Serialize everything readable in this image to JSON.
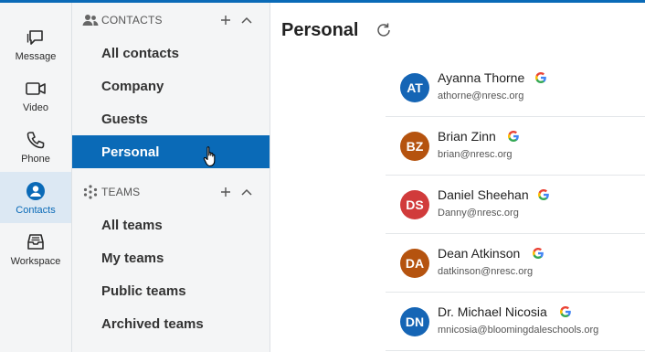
{
  "rail": {
    "items": [
      {
        "label": "Message",
        "icon": "message-icon"
      },
      {
        "label": "Video",
        "icon": "video-icon"
      },
      {
        "label": "Phone",
        "icon": "phone-icon"
      },
      {
        "label": "Contacts",
        "icon": "contacts-icon",
        "active": true
      },
      {
        "label": "Workspace",
        "icon": "workspace-icon"
      }
    ]
  },
  "contacts_section": {
    "title": "CONTACTS",
    "items": [
      {
        "label": "All contacts"
      },
      {
        "label": "Company"
      },
      {
        "label": "Guests"
      },
      {
        "label": "Personal",
        "selected": true
      }
    ]
  },
  "teams_section": {
    "title": "TEAMS",
    "items": [
      {
        "label": "All teams"
      },
      {
        "label": "My teams"
      },
      {
        "label": "Public teams"
      },
      {
        "label": "Archived teams"
      }
    ]
  },
  "main": {
    "title": "Personal",
    "contacts": [
      {
        "initials": "AT",
        "name": "Ayanna Thorne",
        "email": "athorne@nresc.org",
        "color": "#1565b5"
      },
      {
        "initials": "BZ",
        "name": "Brian Zinn",
        "email": "brian@nresc.org",
        "color": "#b5530f"
      },
      {
        "initials": "DS",
        "name": "Daniel Sheehan",
        "email": "Danny@nresc.org",
        "color": "#d13b3b"
      },
      {
        "initials": "DA",
        "name": "Dean Atkinson",
        "email": "datkinson@nresc.org",
        "color": "#b5530f"
      },
      {
        "initials": "DN",
        "name": "Dr. Michael Nicosia",
        "email": "mnicosia@bloomingdaleschools.org",
        "color": "#1565b5"
      }
    ]
  },
  "colors": {
    "accent": "#0a6ab7",
    "rail_bg": "#f4f5f6"
  }
}
